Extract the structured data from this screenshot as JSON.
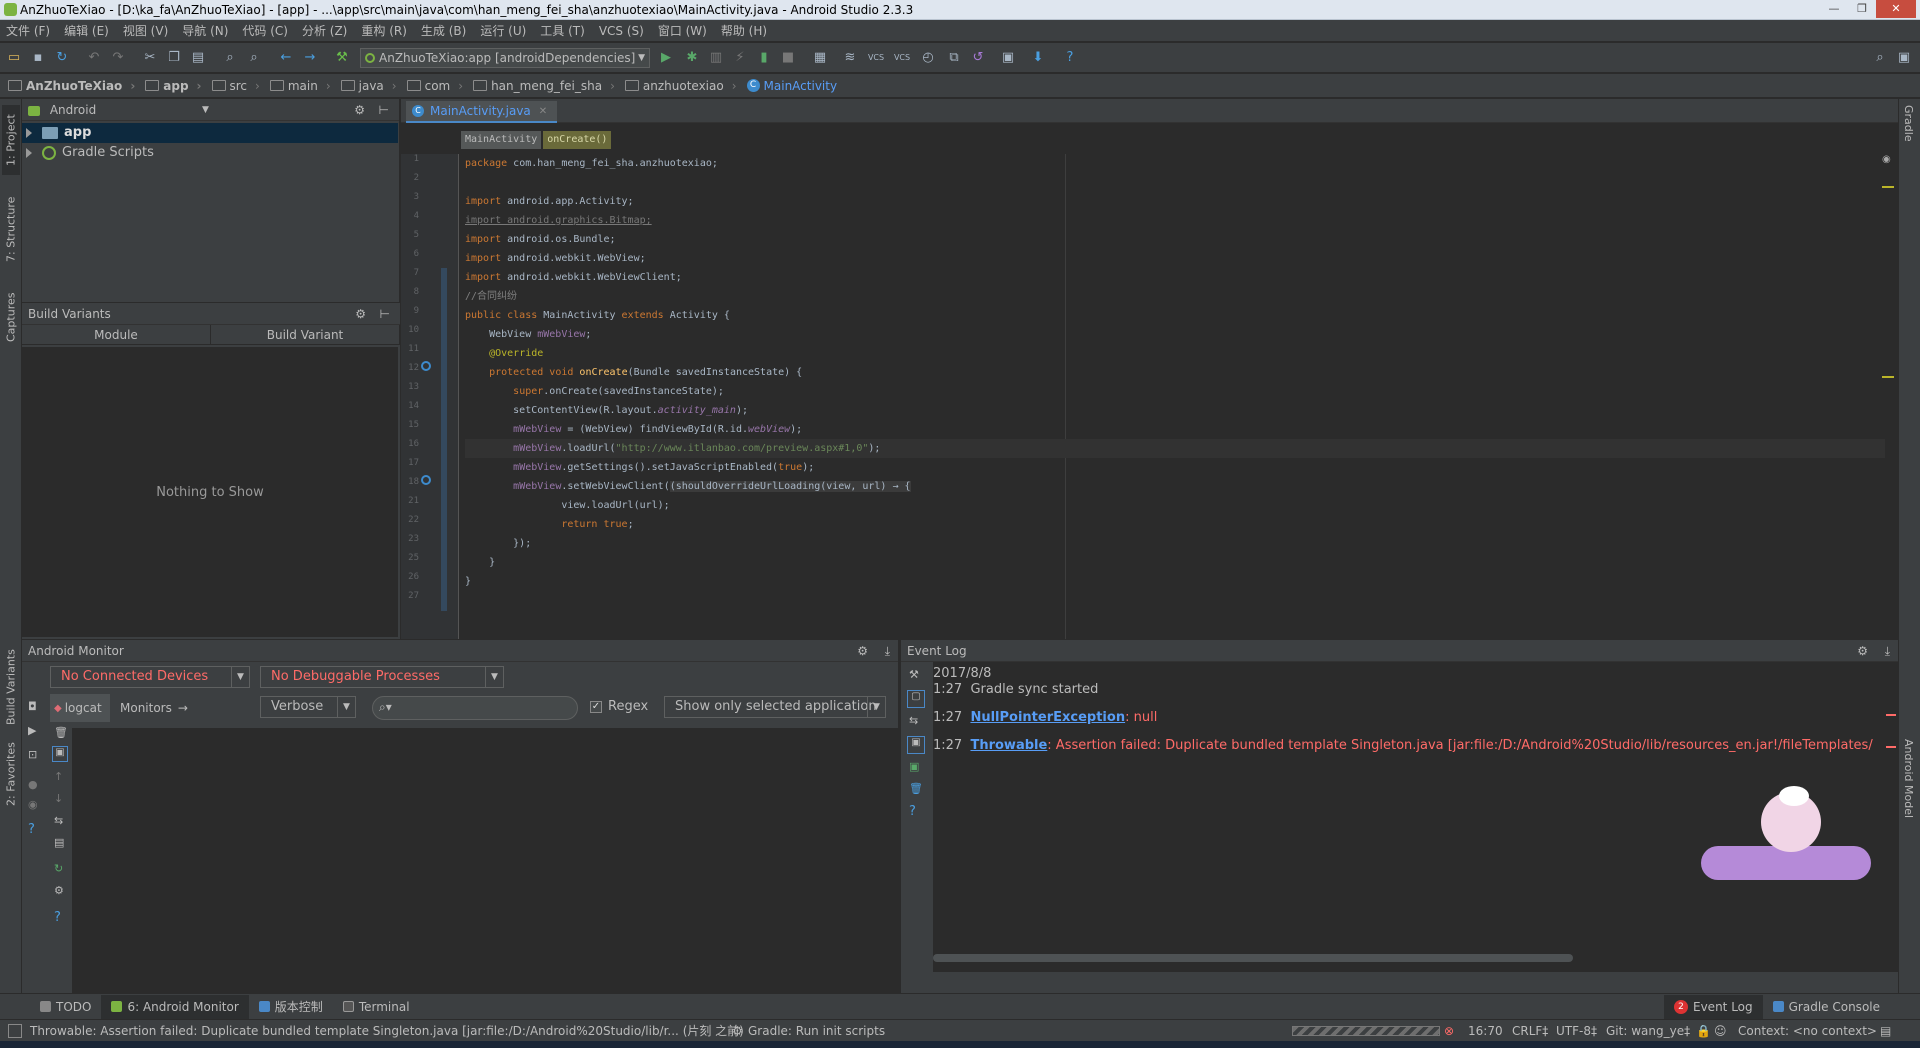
{
  "window": {
    "title": "AnZhuoTeXiao - [D:\\ka_fa\\AnZhuoTeXiao] - [app] - ...\\app\\src\\main\\java\\com\\han_meng_fei_sha\\anzhuotexiao\\MainActivity.java - Android Studio 2.3.3"
  },
  "menu": [
    "文件 (F)",
    "编辑 (E)",
    "视图 (V)",
    "导航 (N)",
    "代码 (C)",
    "分析 (Z)",
    "重构 (R)",
    "生成 (B)",
    "运行 (U)",
    "工具 (T)",
    "VCS (S)",
    "窗口 (W)",
    "帮助 (H)"
  ],
  "toolbar": {
    "run_config": "AnZhuoTeXiao:app [androidDependencies]"
  },
  "breadcrumb": [
    "AnZhuoTeXiao",
    "app",
    "src",
    "main",
    "java",
    "com",
    "han_meng_fei_sha",
    "anzhuotexiao",
    "MainActivity"
  ],
  "project": {
    "view_selector": "Android",
    "tree": [
      "app",
      "Gradle Scripts"
    ],
    "strip_tabs": [
      "1: Project",
      "7: Structure",
      "Captures"
    ]
  },
  "build_variants": {
    "title": "Build Variants",
    "col_module": "Module",
    "col_variant": "Build Variant",
    "empty": "Nothing to Show"
  },
  "editor": {
    "tab": "MainActivity.java",
    "crumbs": [
      "MainActivity",
      "onCreate()"
    ],
    "line_numbers": [
      "1",
      "2",
      "3",
      "4",
      "5",
      "6",
      "7",
      "8",
      "9",
      "10",
      "11",
      "12",
      "13",
      "14",
      "15",
      "16",
      "17",
      "18",
      "21",
      "22",
      "23",
      "25",
      "26",
      "27"
    ]
  },
  "android_monitor": {
    "title": "Android Monitor",
    "devices": "No Connected Devices",
    "processes": "No Debuggable Processes",
    "tab_logcat": "logcat",
    "tab_monitors": "Monitors",
    "level": "Verbose",
    "search_placeholder": "",
    "regex": "Regex",
    "filter": "Show only selected application"
  },
  "event_log": {
    "title": "Event Log",
    "date": "2017/8/8",
    "e1_time": "1:27",
    "e1_text": "Gradle sync started",
    "e2_time": "1:27",
    "e2_link": "NullPointerException",
    "e2_text": ": null",
    "e3_time": "1:27",
    "e3_link": "Throwable",
    "e3_text": ": Assertion failed: Duplicate bundled template Singleton.java [jar:file:/D:/Android%20Studio/lib/resources_en.jar!/fileTemplates/Singleton.java.ft, jar"
  },
  "side_right": [
    "Gradle",
    "Android Model"
  ],
  "side_left_bottom": [
    "Build Variants",
    "2: Favorites"
  ],
  "tool_windows": {
    "todo": "TODO",
    "monitor": "6: Android Monitor",
    "vcs": "版本控制",
    "terminal": "Terminal",
    "event_log_badge": "2",
    "event_log": "Event Log",
    "gradle_console": "Gradle Console"
  },
  "status": {
    "message": "Throwable: Assertion failed: Duplicate bundled template Singleton.java [jar:file:/D:/Android%20Studio/lib/r... (片刻 之前)",
    "task": "Gradle: Run init scripts",
    "position": "16:70",
    "line_sep": "CRLF‡",
    "encoding": "UTF-8‡",
    "git": "Git: wang_ye‡",
    "context": "Context: <no context>"
  },
  "colors": {
    "accent": "#4a88c7",
    "error": "#ff6b68",
    "selection": "#0d293e"
  }
}
